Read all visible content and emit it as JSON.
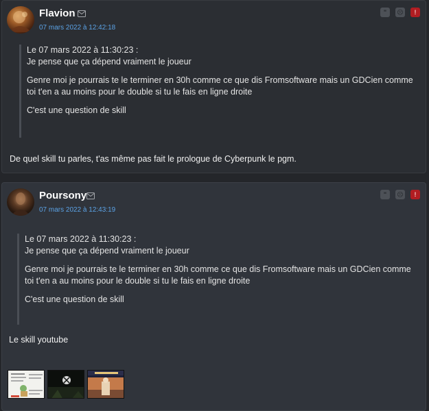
{
  "posts": [
    {
      "username": "Flavion",
      "date": "07 mars 2022 à 12:42:18",
      "quote": {
        "header": "Le 07 mars 2022 à 11:30:23 :",
        "lines": [
          "Je pense que ça dépend vraiment le joueur",
          "Genre moi je pourrais te le terminer en 30h comme ce que dis Fromsoftware mais un GDCien comme toi t'en a au moins pour le double si tu le fais en ligne droite",
          "C'est une question de skill"
        ]
      },
      "body": "De quel skill tu parles, t'as même pas fait le prologue de Cyberpunk le pgm."
    },
    {
      "username": "Poursony",
      "date": "07 mars 2022 à 12:43:19",
      "quote": {
        "header": "Le 07 mars 2022 à 11:30:23 :",
        "lines": [
          "Je pense que ça dépend vraiment le joueur",
          "Genre moi je pourrais te le terminer en 30h comme ce que dis Fromsoftware mais un GDCien comme toi t'en a au moins pour le double si tu le fais en ligne droite",
          "C'est une question de skill"
        ]
      },
      "body": "Le skill youtube",
      "thumbnails": [
        "document-thumbnail",
        "xbox-thumbnail",
        "fallout-cover-thumbnail"
      ]
    }
  ],
  "icons": {
    "mail": "mail-icon",
    "quote": "quote-icon",
    "mp": "private-message-icon",
    "alert": "report-icon"
  },
  "colors": {
    "date_link": "#5ba2e5",
    "alert": "#b11d22"
  }
}
